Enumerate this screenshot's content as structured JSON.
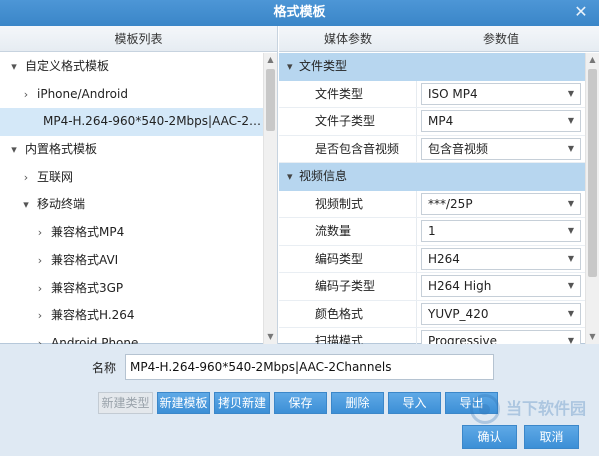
{
  "window": {
    "title": "格式模板"
  },
  "left_panel": {
    "header": "模板列表",
    "tree": [
      {
        "label": "自定义格式模板",
        "level": 0,
        "expanded": true
      },
      {
        "label": "iPhone/Android",
        "level": 1,
        "expanded": false
      },
      {
        "label": "MP4-H.264-960*540-2Mbps|AAC-2Channels",
        "level": 1,
        "leaf": true,
        "selected": true
      },
      {
        "label": "内置格式模板",
        "level": 0,
        "expanded": true
      },
      {
        "label": "互联网",
        "level": 1,
        "expanded": false
      },
      {
        "label": "移动终端",
        "level": 1,
        "expanded": true
      },
      {
        "label": "兼容格式MP4",
        "level": 2,
        "expanded": false
      },
      {
        "label": "兼容格式AVI",
        "level": 2,
        "expanded": false
      },
      {
        "label": "兼容格式3GP",
        "level": 2,
        "expanded": false
      },
      {
        "label": "兼容格式H.264",
        "level": 2,
        "expanded": false
      },
      {
        "label": "Android Phone",
        "level": 2,
        "expanded": false
      }
    ]
  },
  "right_panel": {
    "header_param": "媒体参数",
    "header_value": "参数值",
    "sections": [
      {
        "title": "文件类型",
        "rows": [
          {
            "name": "文件类型",
            "value": "ISO MP4"
          },
          {
            "name": "文件子类型",
            "value": "MP4"
          },
          {
            "name": "是否包含音视频",
            "value": "包含音视频"
          }
        ]
      },
      {
        "title": "视频信息",
        "rows": [
          {
            "name": "视频制式",
            "value": "***/25P"
          },
          {
            "name": "流数量",
            "value": "1"
          },
          {
            "name": "编码类型",
            "value": "H264"
          },
          {
            "name": "编码子类型",
            "value": "H264 High"
          },
          {
            "name": "颜色格式",
            "value": "YUVP_420"
          },
          {
            "name": "扫描模式",
            "value": "Progressive"
          }
        ]
      }
    ]
  },
  "name_field": {
    "label": "名称",
    "value": "MP4-H.264-960*540-2Mbps|AAC-2Channels"
  },
  "buttons": {
    "new_type": "新建类型",
    "new_template": "新建模板",
    "copy_new": "拷贝新建",
    "save": "保存",
    "delete": "删除",
    "import": "导入",
    "export": "导出",
    "confirm": "确认",
    "cancel": "取消"
  },
  "watermark": {
    "text": "当下软件园"
  },
  "icons": {
    "close": "close-icon",
    "expand": "chevron-down-icon",
    "collapse": "chevron-right-icon",
    "dropdown": "dropdown-caret-icon"
  },
  "colors": {
    "titlebar": "#3a86c8",
    "section_bg": "#b7d6ef",
    "selected_row": "#d4e8f8",
    "button": "#3c8fd6"
  }
}
